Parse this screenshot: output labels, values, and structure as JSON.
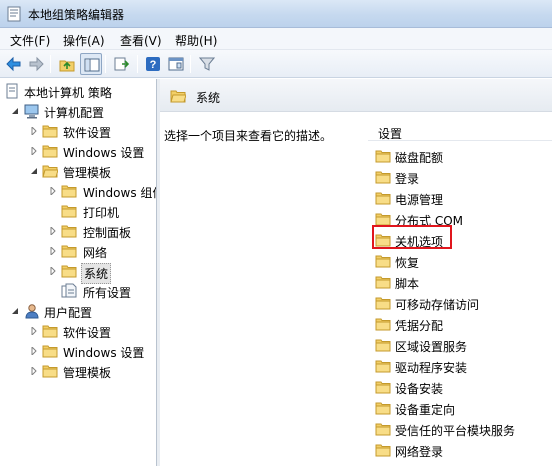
{
  "window": {
    "title": "本地组策略编辑器"
  },
  "menu": [
    {
      "label": "文件(F)"
    },
    {
      "label": "操作(A)"
    },
    {
      "label": "查看(V)"
    },
    {
      "label": "帮助(H)"
    }
  ],
  "toolbar": {
    "buttons": [
      "back-icon",
      "forward-icon",
      "up-folder-icon",
      "show-hide-tree-icon",
      "export-list-icon",
      "help-icon",
      "properties-icon",
      "filter-icon"
    ]
  },
  "tree": {
    "root": "本地计算机 策略",
    "computer_config": "计算机配置",
    "cc_software": "软件设置",
    "cc_windows": "Windows 设置",
    "cc_admin": "管理模板",
    "admin_windows_comp": "Windows 组件",
    "admin_printers": "打印机",
    "admin_control_panel": "控制面板",
    "admin_network": "网络",
    "admin_system": "系统",
    "admin_all": "所有设置",
    "user_config": "用户配置",
    "uc_software": "软件设置",
    "uc_windows": "Windows 设置",
    "uc_admin": "管理模板"
  },
  "details": {
    "node_title": "系统",
    "description_prompt": "选择一个项目来查看它的描述。",
    "column_header": "设置",
    "items": [
      "磁盘配额",
      "登录",
      "电源管理",
      "分布式 COM",
      "关机选项",
      "恢复",
      "脚本",
      "可移动存储访问",
      "凭据分配",
      "区域设置服务",
      "驱动程序安装",
      "设备安装",
      "设备重定向",
      "受信任的平台模块服务",
      "网络登录"
    ],
    "highlighted_item": "关机选项"
  },
  "colors": {
    "folder": "#f2cf68",
    "highlight_border": "#e0161d",
    "title_bar": "#c6d9ef"
  }
}
